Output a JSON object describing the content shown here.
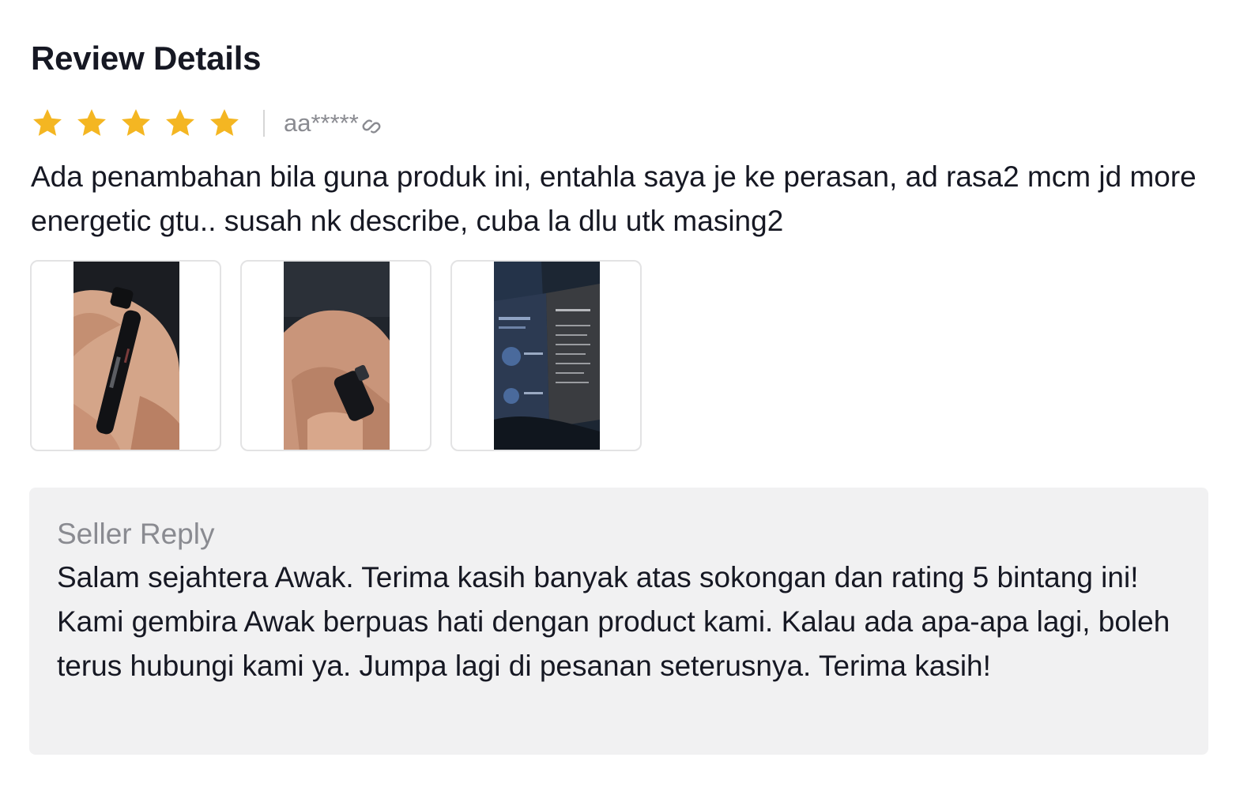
{
  "header": {
    "title": "Review Details"
  },
  "review": {
    "rating": 5,
    "max_rating": 5,
    "star_color": "#f4b622",
    "username": "aa*****",
    "user_icon": "link-icon",
    "text": "Ada penambahan bila guna produk ini, entahla saya je ke perasan, ad rasa2 mcm jd more energetic gtu.. susah nk describe, cuba la dlu utk masing2",
    "images": [
      {
        "name": "review-photo-1",
        "subject": "hand holding black spray pen"
      },
      {
        "name": "review-photo-2",
        "subject": "fingers holding black spray bottle"
      },
      {
        "name": "review-photo-3",
        "subject": "instruction leaflet"
      }
    ]
  },
  "seller_reply": {
    "title": "Seller Reply",
    "text": "Salam sejahtera Awak. Terima kasih banyak atas sokongan dan rating 5 bintang ini! Kami gembira Awak berpuas hati dengan product kami. Kalau ada apa-apa lagi, boleh terus hubungi kami ya. Jumpa lagi di pesanan seterusnya. Terima kasih!"
  }
}
